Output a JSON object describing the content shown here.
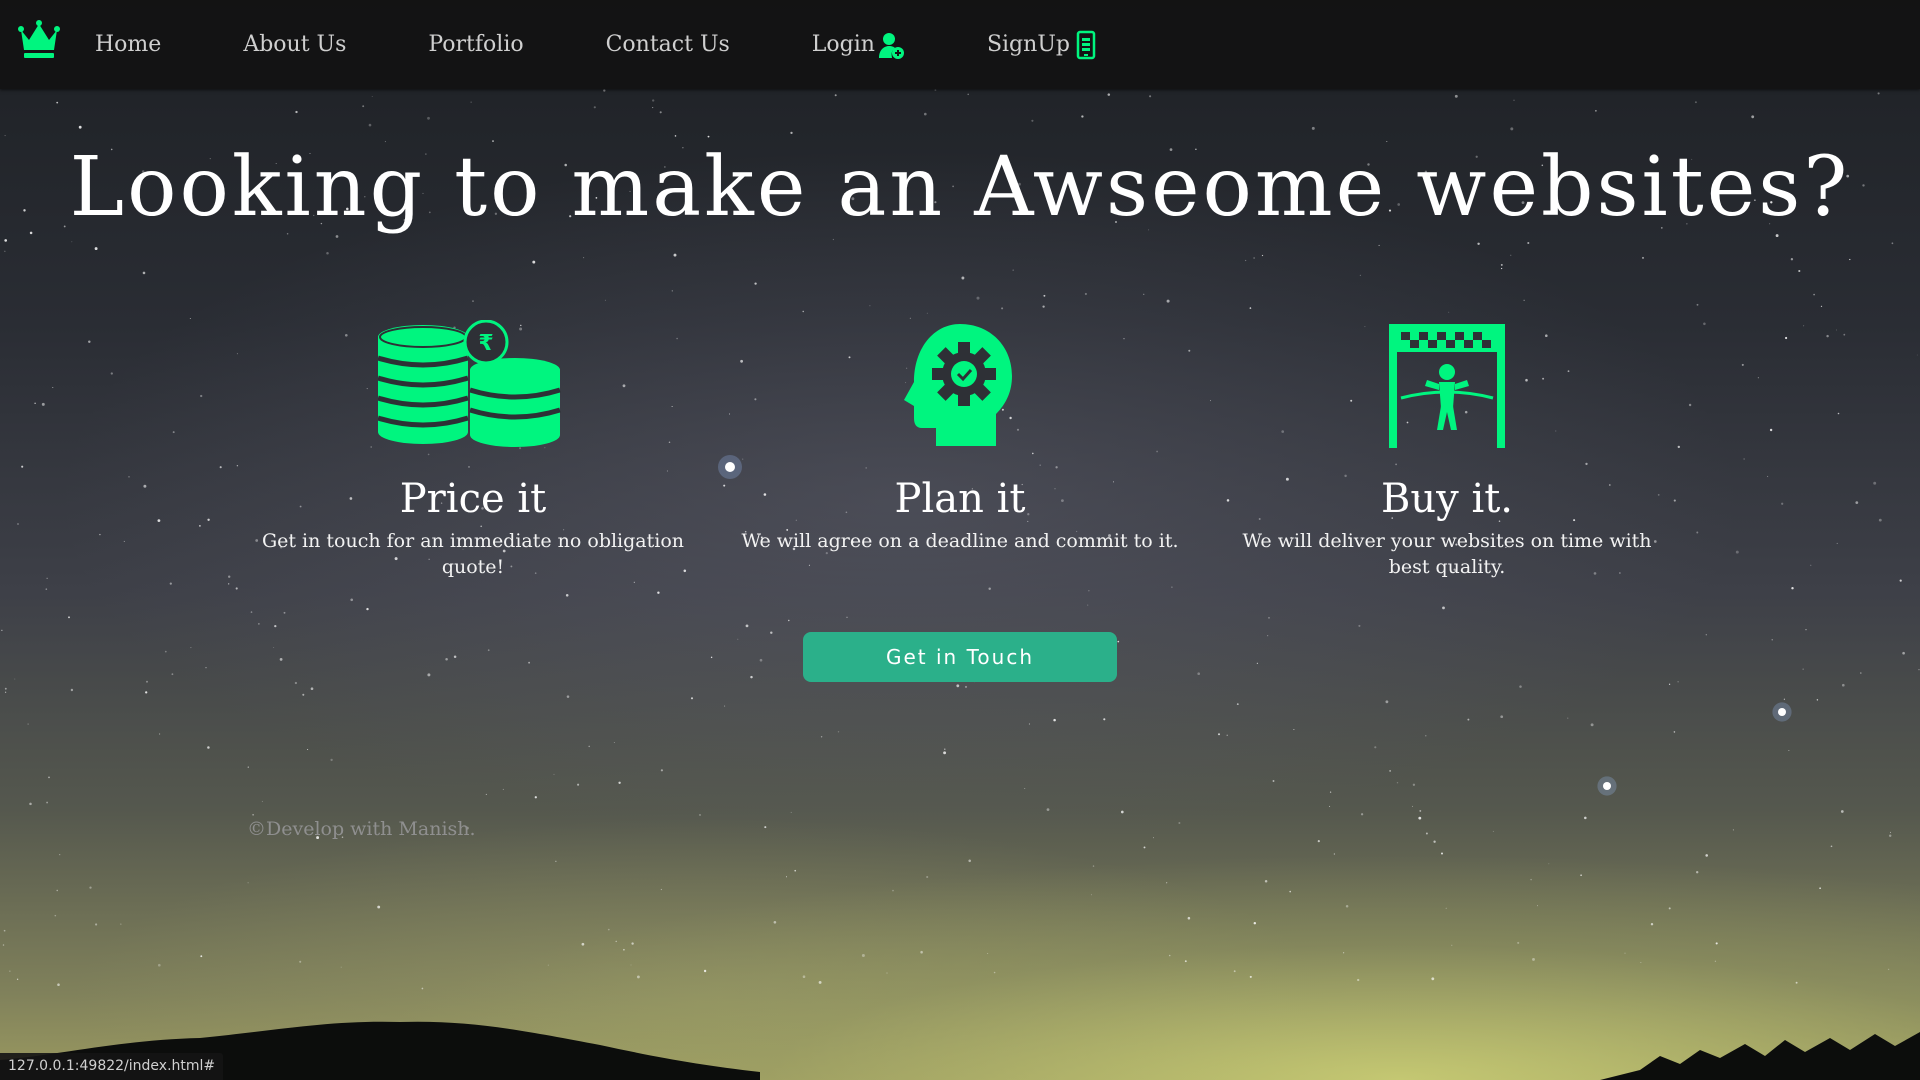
{
  "nav": {
    "links": [
      {
        "label": "Home"
      },
      {
        "label": "About Us"
      },
      {
        "label": "Portfolio"
      },
      {
        "label": "Contact Us"
      },
      {
        "label": "Login",
        "icon": "user-add-icon"
      },
      {
        "label": "SignUp",
        "icon": "mobile-icon"
      }
    ]
  },
  "hero": {
    "title": "Looking to make an Awseome websites?"
  },
  "features": [
    {
      "icon": "coins-rupee-icon",
      "title": "Price it",
      "description": "Get in touch for an immediate no obligation quote!"
    },
    {
      "icon": "head-gear-icon",
      "title": "Plan it",
      "description": "We will agree on a deadline and commit to it."
    },
    {
      "icon": "finish-line-icon",
      "title": "Buy it.",
      "description": "We will deliver your websites on time with best quality."
    }
  ],
  "cta": {
    "label": "Get in Touch"
  },
  "footer": {
    "text": "©Develop with Manish."
  },
  "status_bar": {
    "url": "127.0.0.1:49822/index.html#"
  },
  "colors": {
    "accent": "#00f57f",
    "button": "#2bb08a",
    "nav_bg": "#121212"
  }
}
